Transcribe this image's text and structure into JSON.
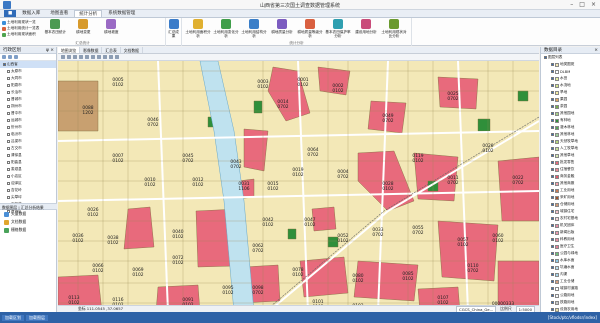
{
  "window": {
    "title": "山西省第三次国土调查数据管理系统"
  },
  "menu_tabs": [
    "数据入库",
    "地图查看",
    "统计分析",
    "系统数据管理"
  ],
  "ribbon": {
    "group1": {
      "small_buttons": [
        "土地利用现状一览",
        "土地利用统计一览表",
        "土地利用现状面积"
      ],
      "buttons": [
        "基本农田统计",
        "耕地变更",
        "耕地坡度",
        "汇总成果"
      ],
      "label": "汇总统计"
    },
    "group2": {
      "buttons": [
        "土地利用面积分析",
        "土地利用变化分析",
        "土地利用结构分析",
        "耕地质量分析",
        "耕地质量等级分析",
        "基本农田保护率分析",
        "建设用地分析",
        "土地利用现状对比分析",
        "基本农田保护区分析",
        "建设用地占用分析"
      ],
      "label": "统计分析"
    }
  },
  "left_panel": {
    "title": "行政区划",
    "pin": "ψ ×",
    "root": "山西省",
    "items": [
      "太原市",
      "大同市",
      "阳泉市",
      "长治市",
      "晋城市",
      "朔州市",
      "晋中市",
      "运城市",
      "忻州市",
      "临汾市",
      "吕梁市",
      "古交市",
      "清徐县",
      "阳曲县",
      "娄烦县",
      "小店区",
      "迎泽区",
      "杏花岭",
      "尖草坪",
      "万柏林",
      "晋源区"
    ],
    "layer_title": "数据图层 | 汇总分析结果",
    "layers": [
      "矢量数据",
      "文档数据",
      "栅格数据"
    ],
    "bottom_tabs": [
      "数据查看",
      "行政区划"
    ]
  },
  "doc_tabs": [
    "地图浏览",
    "影像数据",
    "汇总表",
    "文档数据"
  ],
  "map": {
    "parcels": [
      {
        "code": "0088",
        "sub": "1202"
      },
      {
        "code": "0001",
        "sub": "0102"
      },
      {
        "code": "0003",
        "sub": "0102"
      },
      {
        "code": "0002",
        "sub": "0102"
      },
      {
        "code": "0025",
        "sub": "0702"
      },
      {
        "code": "0014",
        "sub": "0702"
      },
      {
        "code": "0046",
        "sub": "0702"
      },
      {
        "code": "0049",
        "sub": "0702"
      },
      {
        "code": "0064",
        "sub": "0702"
      },
      {
        "code": "0045",
        "sub": "0702"
      },
      {
        "code": "0043",
        "sub": "0702"
      },
      {
        "code": "0011",
        "sub": "0702"
      },
      {
        "code": "0004",
        "sub": "0702"
      },
      {
        "code": "0031",
        "sub": "1106"
      },
      {
        "code": "0005",
        "sub": "0102"
      },
      {
        "code": "0007",
        "sub": "0102"
      },
      {
        "code": "0010",
        "sub": "0102"
      },
      {
        "code": "0012",
        "sub": "0102"
      },
      {
        "code": "0015",
        "sub": "0102"
      },
      {
        "code": "0019",
        "sub": "0102"
      },
      {
        "code": "0020",
        "sub": "0102"
      },
      {
        "code": "0022",
        "sub": "0702"
      },
      {
        "code": "0026",
        "sub": "0102"
      },
      {
        "code": "0028",
        "sub": "0102"
      },
      {
        "code": "0033",
        "sub": "0702"
      },
      {
        "code": "0036",
        "sub": "0102"
      },
      {
        "code": "0038",
        "sub": "0102"
      },
      {
        "code": "0040",
        "sub": "0102"
      },
      {
        "code": "0042",
        "sub": "0102"
      },
      {
        "code": "0047",
        "sub": "0102"
      },
      {
        "code": "0052",
        "sub": "0102"
      },
      {
        "code": "0055",
        "sub": "0702"
      },
      {
        "code": "0057",
        "sub": "0102"
      },
      {
        "code": "0060",
        "sub": "0102"
      },
      {
        "code": "0062",
        "sub": "0702"
      },
      {
        "code": "0066",
        "sub": "0102"
      },
      {
        "code": "0069",
        "sub": "0102"
      },
      {
        "code": "0072",
        "sub": "0102"
      },
      {
        "code": "0078",
        "sub": "0102"
      },
      {
        "code": "0080",
        "sub": "0102"
      },
      {
        "code": "0085",
        "sub": "0102"
      },
      {
        "code": "00000333",
        "sub": "0702"
      },
      {
        "code": "0091",
        "sub": "0102"
      },
      {
        "code": "0095",
        "sub": "0102"
      },
      {
        "code": "0098",
        "sub": "0702"
      },
      {
        "code": "0101",
        "sub": "0102"
      },
      {
        "code": "0103",
        "sub": "0102"
      },
      {
        "code": "0107",
        "sub": "0102"
      },
      {
        "code": "0110",
        "sub": "0702"
      },
      {
        "code": "0113",
        "sub": "0102"
      },
      {
        "code": "0116",
        "sub": "0102"
      },
      {
        "code": "0119",
        "sub": "0102"
      }
    ],
    "colors": {
      "base": "#f3e8b7",
      "red": "#e86a7c",
      "river": "#bfe2ef",
      "green": "#2f8f3a",
      "road": "#ffffff",
      "line": "#7a6a3a"
    }
  },
  "map_status": {
    "coords": "坐标 111.0545 ,37.0657",
    "scale_label": "比例尺",
    "scale": "1:5000",
    "crs": "CGCS_China_Ge..."
  },
  "right_panel": {
    "title": "数据目录",
    "root": "图层列表",
    "items": [
      {
        "label": "地类图斑",
        "color": "#f3e8b7"
      },
      {
        "label": "DLBM",
        "color": "#ffffff"
      },
      {
        "label": "水田",
        "color": "#e6f0a3"
      },
      {
        "label": "水浇地",
        "color": "#d6e88c"
      },
      {
        "label": "旱地",
        "color": "#f6efa6"
      },
      {
        "label": "果园",
        "color": "#e2a860"
      },
      {
        "label": "茶园",
        "color": "#78b04a"
      },
      {
        "label": "其他园地",
        "color": "#a9d28a"
      },
      {
        "label": "有林地",
        "color": "#2f8f3a"
      },
      {
        "label": "灌木林地",
        "color": "#57a85a"
      },
      {
        "label": "其他林地",
        "color": "#9dd09a"
      },
      {
        "label": "天然牧草地",
        "color": "#b6d77a"
      },
      {
        "label": "人工牧草地",
        "color": "#c9e299"
      },
      {
        "label": "其他草地",
        "color": "#d7eab2"
      },
      {
        "label": "批发零售",
        "color": "#e86a7c"
      },
      {
        "label": "住宿餐饮",
        "color": "#f08a97"
      },
      {
        "label": "商务金融",
        "color": "#e55a6b"
      },
      {
        "label": "其他商服",
        "color": "#f3a2ad"
      },
      {
        "label": "工业用地",
        "color": "#c77b57"
      },
      {
        "label": "采矿用地",
        "color": "#a0522d"
      },
      {
        "label": "仓储用地",
        "color": "#d19a77"
      },
      {
        "label": "城镇住宅",
        "color": "#f5c2c8"
      },
      {
        "label": "农村宅基地",
        "color": "#f4d6da"
      },
      {
        "label": "机关团体",
        "color": "#e990a6"
      },
      {
        "label": "新闻出版",
        "color": "#eb9bb0"
      },
      {
        "label": "科教用地",
        "color": "#ec8ea3"
      },
      {
        "label": "医疗卫生",
        "color": "#e67f96"
      },
      {
        "label": "公园与绿地",
        "color": "#6fc27a"
      },
      {
        "label": "水库水面",
        "color": "#8fcbe6"
      },
      {
        "label": "坑塘水面",
        "color": "#bfe2ef"
      },
      {
        "label": "沟渠",
        "color": "#a7d6ea"
      },
      {
        "label": "工业仓储",
        "color": "#d9a07f"
      },
      {
        "label": "城镇村道路",
        "color": "#ffffff"
      },
      {
        "label": "公路用地",
        "color": "#f7f7f7"
      },
      {
        "label": "铁路用地",
        "color": "#cccccc"
      },
      {
        "label": "设施农用地",
        "color": "#e8e0a3"
      },
      {
        "label": "裸地",
        "color": "#dddddd"
      }
    ]
  },
  "bottom": {
    "left_tabs": [
      "加载区划",
      "加载图层"
    ],
    "right_text": "[Stock/ptc/vflodsr/index]"
  }
}
